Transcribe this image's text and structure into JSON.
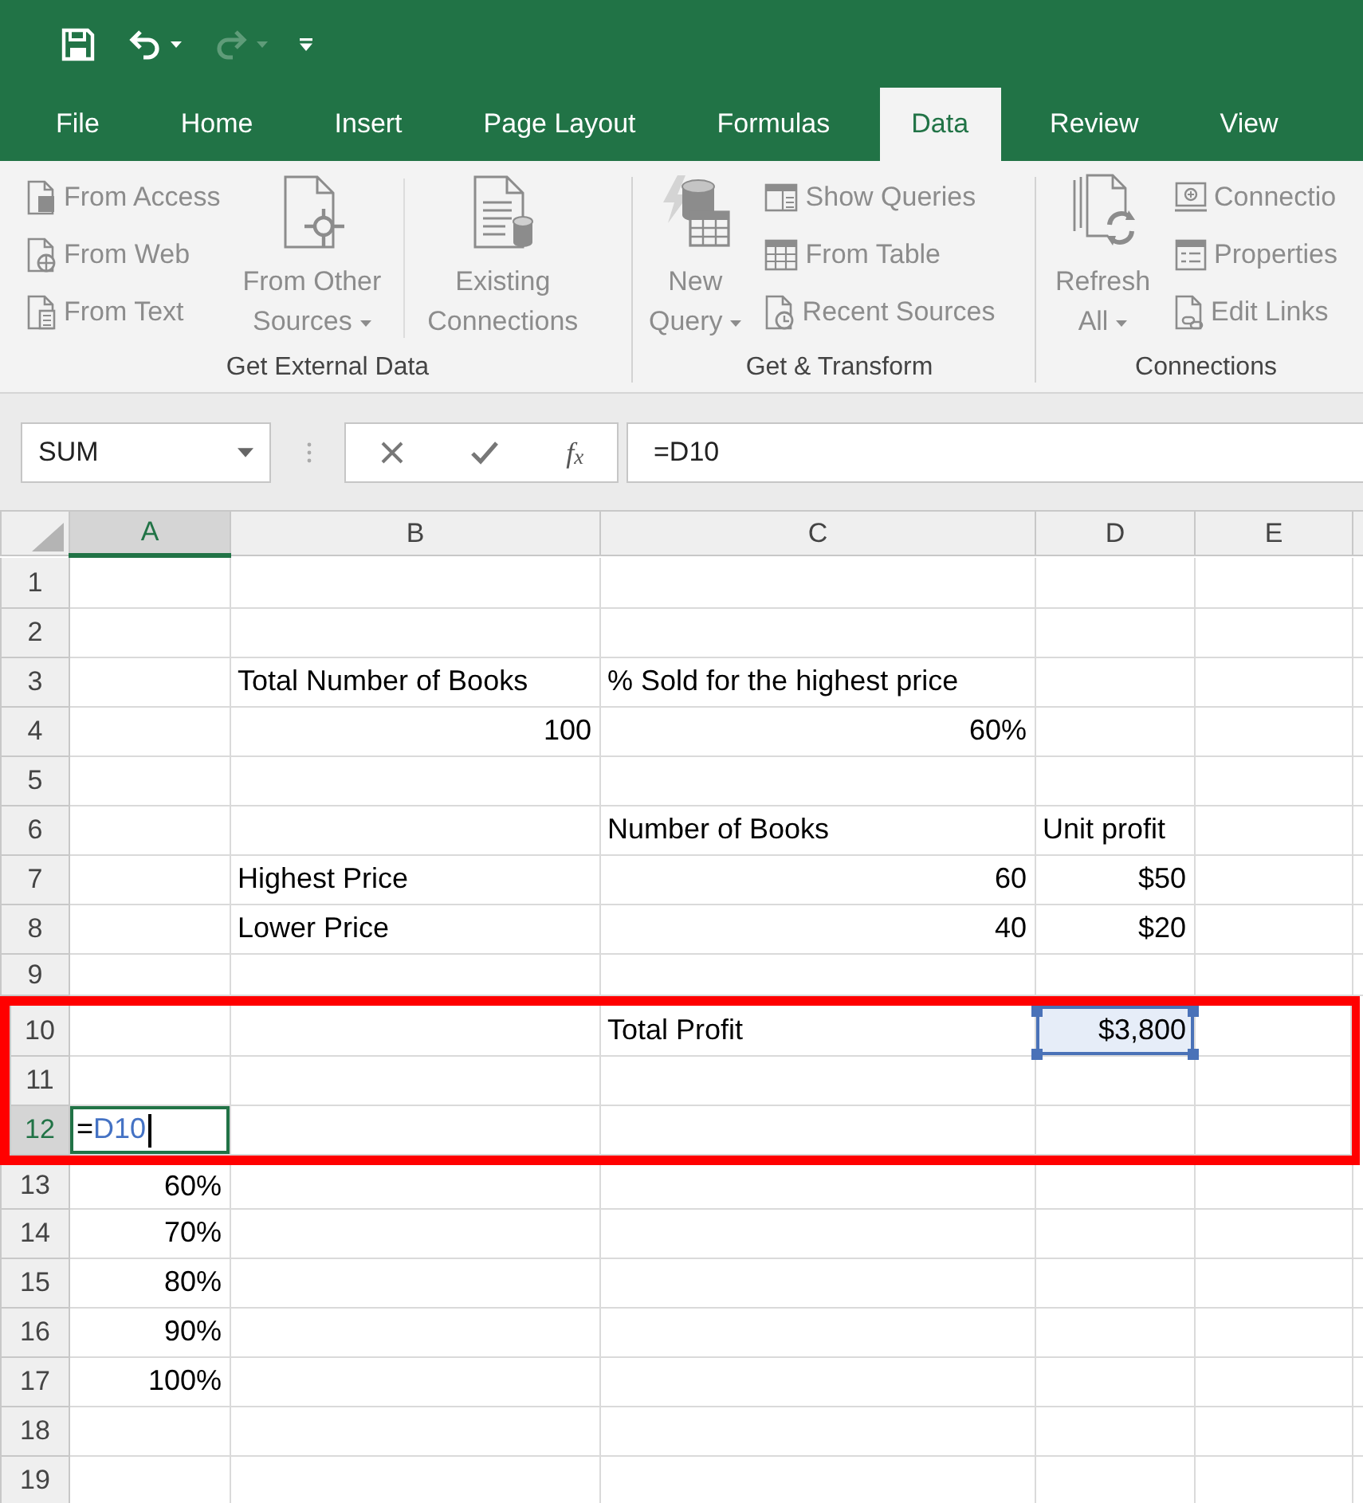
{
  "quick_access": [
    {
      "kind": "save",
      "disabled": false,
      "dropdown": false
    },
    {
      "kind": "undo",
      "disabled": false,
      "dropdown": true
    },
    {
      "kind": "redo",
      "disabled": true,
      "dropdown": true
    },
    {
      "kind": "customize",
      "disabled": false,
      "dropdown": false
    }
  ],
  "tabs": [
    {
      "label": "File",
      "selected": false
    },
    {
      "label": "Home",
      "selected": false
    },
    {
      "label": "Insert",
      "selected": false
    },
    {
      "label": "Page Layout",
      "selected": false
    },
    {
      "label": "Formulas",
      "selected": false
    },
    {
      "label": "Data",
      "selected": true
    },
    {
      "label": "Review",
      "selected": false
    },
    {
      "label": "View",
      "selected": false
    }
  ],
  "ribbon": {
    "groups": [
      {
        "label": "Get External Data",
        "items": [
          {
            "kind": "stack",
            "buttons": [
              {
                "label": "From Access",
                "disabled": true
              },
              {
                "label": "From Web",
                "disabled": true
              },
              {
                "label": "From Text",
                "disabled": true
              }
            ]
          },
          {
            "kind": "large",
            "lines": [
              "From Other",
              "Sources"
            ],
            "dropdown": true,
            "disabled": true,
            "divider_before": false
          },
          {
            "kind": "large",
            "lines": [
              "Existing",
              "Connections"
            ],
            "dropdown": false,
            "disabled": true,
            "divider_before": true
          }
        ]
      },
      {
        "label": "Get & Transform",
        "items": [
          {
            "kind": "large",
            "lines": [
              "New",
              "Query"
            ],
            "dropdown": true,
            "disabled": true,
            "divider_before": false
          },
          {
            "kind": "stack",
            "buttons": [
              {
                "label": "Show Queries",
                "disabled": true
              },
              {
                "label": "From Table",
                "disabled": true
              },
              {
                "label": "Recent Sources",
                "disabled": true
              }
            ]
          }
        ]
      },
      {
        "label": "Connections",
        "items": [
          {
            "kind": "large",
            "lines": [
              "Refresh",
              "All"
            ],
            "dropdown": true,
            "disabled": true,
            "divider_before": false
          },
          {
            "kind": "stack",
            "buttons": [
              {
                "label": "Connectio",
                "disabled": true
              },
              {
                "label": "Properties",
                "disabled": true
              },
              {
                "label": "Edit Links",
                "disabled": true
              }
            ]
          }
        ]
      }
    ]
  },
  "formula_bar": {
    "name_box": "SUM",
    "function_label": "f$_{x}$",
    "formula": "=D10"
  },
  "sheet": {
    "columns": [
      {
        "label": "A",
        "selected": true
      },
      {
        "label": "B",
        "selected": false
      },
      {
        "label": "C",
        "selected": false
      },
      {
        "label": "D",
        "selected": false
      },
      {
        "label": "E",
        "selected": false
      }
    ],
    "rows": [
      {
        "label": "1",
        "selected": false,
        "highlighted": false,
        "cells": [
          {},
          {},
          {},
          {},
          {}
        ]
      },
      {
        "label": "2",
        "selected": false,
        "highlighted": false,
        "cells": [
          {},
          {},
          {},
          {},
          {}
        ]
      },
      {
        "label": "3",
        "selected": false,
        "highlighted": false,
        "cells": [
          {},
          {
            "kind": "text",
            "text": "Total Number of Books"
          },
          {
            "kind": "text",
            "text": "% Sold for the highest price"
          },
          {},
          {}
        ]
      },
      {
        "label": "4",
        "selected": false,
        "highlighted": false,
        "cells": [
          {},
          {
            "kind": "number",
            "text": "100"
          },
          {
            "kind": "number",
            "text": "60%"
          },
          {},
          {}
        ]
      },
      {
        "label": "5",
        "selected": false,
        "highlighted": false,
        "cells": [
          {},
          {},
          {},
          {},
          {}
        ]
      },
      {
        "label": "6",
        "selected": false,
        "highlighted": false,
        "cells": [
          {},
          {},
          {
            "kind": "text",
            "text": "Number of Books"
          },
          {
            "kind": "text",
            "text": "Unit profit"
          },
          {}
        ]
      },
      {
        "label": "7",
        "selected": false,
        "highlighted": false,
        "cells": [
          {},
          {
            "kind": "text",
            "text": "Highest Price"
          },
          {
            "kind": "number",
            "text": "60"
          },
          {
            "kind": "number",
            "text": "$50"
          },
          {}
        ]
      },
      {
        "label": "8",
        "selected": false,
        "highlighted": false,
        "cells": [
          {},
          {
            "kind": "text",
            "text": "Lower Price"
          },
          {
            "kind": "number",
            "text": "40"
          },
          {
            "kind": "number",
            "text": "$20"
          },
          {}
        ]
      },
      {
        "label": "9",
        "selected": false,
        "highlighted": false,
        "cells": [
          {},
          {},
          {},
          {},
          {}
        ]
      },
      {
        "label": "10",
        "selected": false,
        "highlighted": true,
        "cells": [
          {},
          {},
          {
            "kind": "text",
            "text": "Total Profit"
          },
          {
            "kind": "reference",
            "text": "$3,800"
          },
          {}
        ]
      },
      {
        "label": "11",
        "selected": false,
        "highlighted": true,
        "cells": [
          {},
          {},
          {},
          {},
          {}
        ]
      },
      {
        "label": "12",
        "selected": true,
        "highlighted": true,
        "cells": [
          {
            "kind": "formula_input",
            "prefix": "=",
            "reference": "D10"
          },
          {},
          {},
          {},
          {}
        ]
      },
      {
        "label": "13",
        "selected": false,
        "highlighted": false,
        "cells": [
          {
            "kind": "number",
            "text": "60%"
          },
          {},
          {},
          {},
          {}
        ]
      },
      {
        "label": "14",
        "selected": false,
        "highlighted": false,
        "cells": [
          {
            "kind": "number",
            "text": "70%"
          },
          {},
          {},
          {},
          {}
        ]
      },
      {
        "label": "15",
        "selected": false,
        "highlighted": false,
        "cells": [
          {
            "kind": "number",
            "text": "80%"
          },
          {},
          {},
          {},
          {}
        ]
      },
      {
        "label": "16",
        "selected": false,
        "highlighted": false,
        "cells": [
          {
            "kind": "number",
            "text": "90%"
          },
          {},
          {},
          {},
          {}
        ]
      },
      {
        "label": "17",
        "selected": false,
        "highlighted": false,
        "cells": [
          {
            "kind": "number",
            "text": "100%"
          },
          {},
          {},
          {},
          {}
        ]
      },
      {
        "label": "18",
        "selected": false,
        "highlighted": false,
        "cells": [
          {},
          {},
          {},
          {},
          {}
        ]
      },
      {
        "label": "19",
        "selected": false,
        "highlighted": false,
        "cells": [
          {},
          {},
          {},
          {},
          {}
        ]
      }
    ]
  }
}
